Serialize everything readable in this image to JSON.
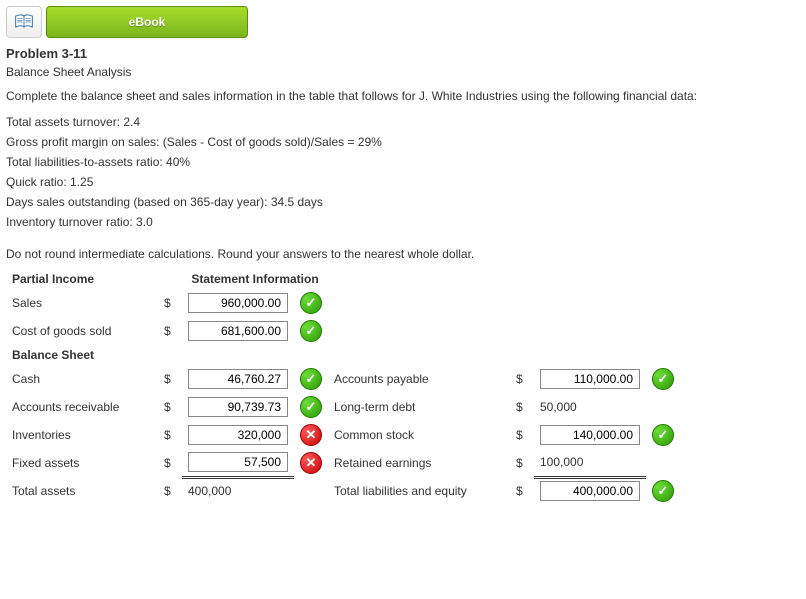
{
  "header": {
    "ebook_label": "eBook"
  },
  "problem": {
    "title": "Problem 3-11",
    "subtitle": "Balance Sheet Analysis",
    "instruction": "Complete the balance sheet and sales information in the table that follows for J. White Industries using the following financial data:",
    "data_lines": [
      "Total assets turnover: 2.4",
      "Gross profit margin on sales: (Sales - Cost of goods sold)/Sales = 29%",
      "Total liabilities-to-assets ratio: 40%",
      "Quick ratio: 1.25",
      "Days sales outstanding (based on 365-day year): 34.5 days",
      "Inventory turnover ratio: 3.0"
    ],
    "note": "Do not round intermediate calculations. Round your answers to the nearest whole dollar."
  },
  "table": {
    "currency": "$",
    "income_header_left": "Partial Income",
    "income_header_right": "Statement Information",
    "balance_header": "Balance Sheet",
    "rows": {
      "sales": {
        "label": "Sales",
        "value": "960,000.00",
        "status": "correct"
      },
      "cogs": {
        "label": "Cost of goods sold",
        "value": "681,600.00",
        "status": "correct"
      },
      "cash": {
        "label": "Cash",
        "value": "46,760.27",
        "status": "correct"
      },
      "ar": {
        "label": "Accounts receivable",
        "value": "90,739.73",
        "status": "correct"
      },
      "inv": {
        "label": "Inventories",
        "value": "320,000",
        "status": "incorrect"
      },
      "fixed": {
        "label": "Fixed assets",
        "value": "57,500",
        "status": "incorrect"
      },
      "ta": {
        "label": "Total assets",
        "static": "400,000"
      },
      "ap": {
        "label": "Accounts payable",
        "value": "110,000.00",
        "status": "correct"
      },
      "ltd": {
        "label": "Long-term debt",
        "static": "50,000"
      },
      "cs": {
        "label": "Common stock",
        "value": "140,000.00",
        "status": "correct"
      },
      "re": {
        "label": "Retained earnings",
        "static": "100,000"
      },
      "tle": {
        "label": "Total liabilities and equity",
        "value": "400,000.00",
        "status": "correct"
      }
    }
  }
}
